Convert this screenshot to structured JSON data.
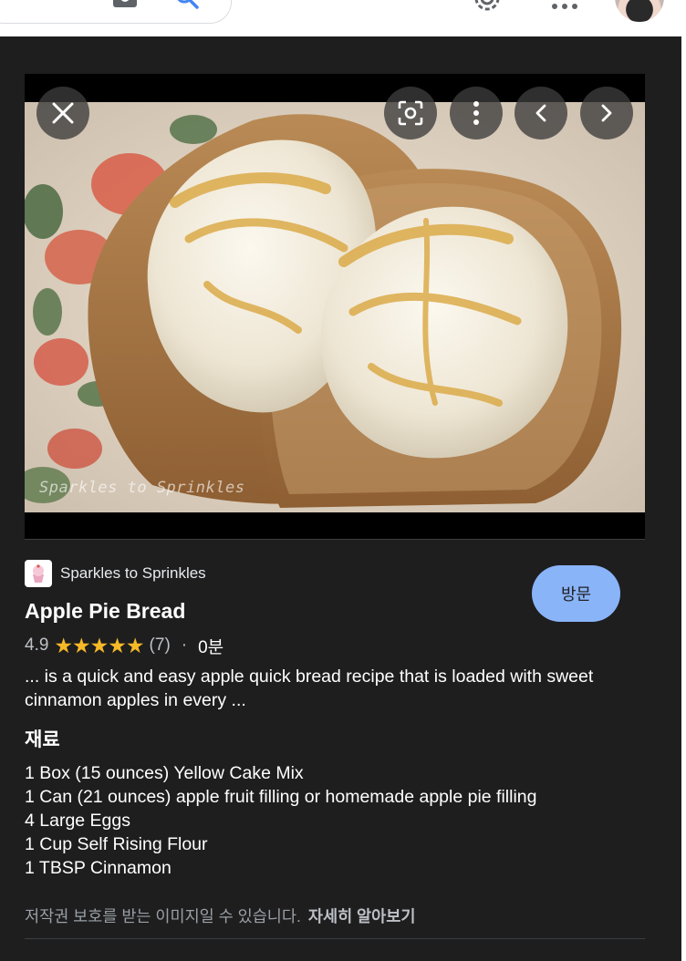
{
  "header": {
    "icons": [
      "camera-search-icon",
      "search-icon",
      "settings-icon",
      "more-apps-icon",
      "avatar"
    ]
  },
  "viewer": {
    "watermark": "Sparkles to Sprinkles",
    "controls": [
      "close-icon",
      "lens-search-icon",
      "more-vert-icon",
      "chevron-left-icon",
      "chevron-right-icon"
    ]
  },
  "result": {
    "source_name": "Sparkles to Sprinkles",
    "title": "Apple Pie Bread",
    "rating": "4.9",
    "stars": 5,
    "rating_count": "(7)",
    "separator": "·",
    "duration": "0분",
    "snippet": "... is a quick and easy apple quick bread recipe that is loaded with sweet cinnamon apples in every ...",
    "ingredients_heading": "재료",
    "ingredients": [
      "1 Box (15 ounces) Yellow Cake Mix",
      "1 Can (21 ounces) apple fruit filling or homemade apple pie filling",
      "4 Large Eggs",
      "1 Cup Self Rising Flour",
      "1 TBSP Cinnamon"
    ],
    "visit_label": "방문"
  },
  "footer": {
    "copyright_text": "저작권 보호를 받는 이미지일 수 있습니다.",
    "learn_more": "자세히 알아보기"
  },
  "colors": {
    "panel_bg": "#1e1e1f",
    "accent": "#8ab4f8",
    "star": "#f7b928",
    "google_blue": "#4285f4"
  }
}
